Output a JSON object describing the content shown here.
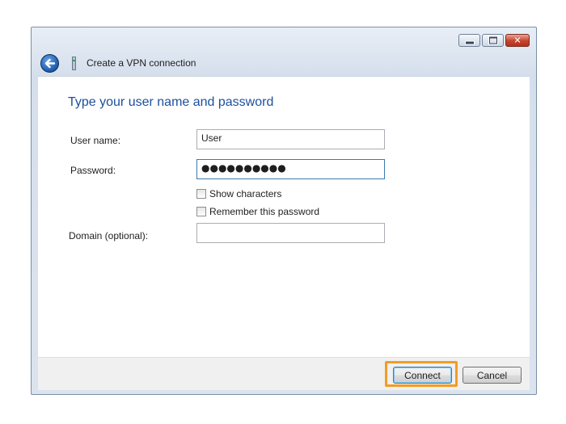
{
  "window": {
    "title": "Create a VPN connection",
    "close_glyph": "✕"
  },
  "content": {
    "heading": "Type your user name and password",
    "username_label": "User name:",
    "username_value": "User",
    "password_label": "Password:",
    "password_value": "●●●●●●●●●●",
    "show_characters_label": "Show characters",
    "remember_password_label": "Remember this password",
    "domain_label": "Domain (optional):",
    "domain_value": ""
  },
  "footer": {
    "connect_label": "Connect",
    "cancel_label": "Cancel"
  },
  "colors": {
    "heading": "#1c4f9c",
    "highlight": "#f39c23"
  },
  "icons": {
    "back": "back-arrow-icon",
    "vpn": "vpn-network-icon"
  }
}
